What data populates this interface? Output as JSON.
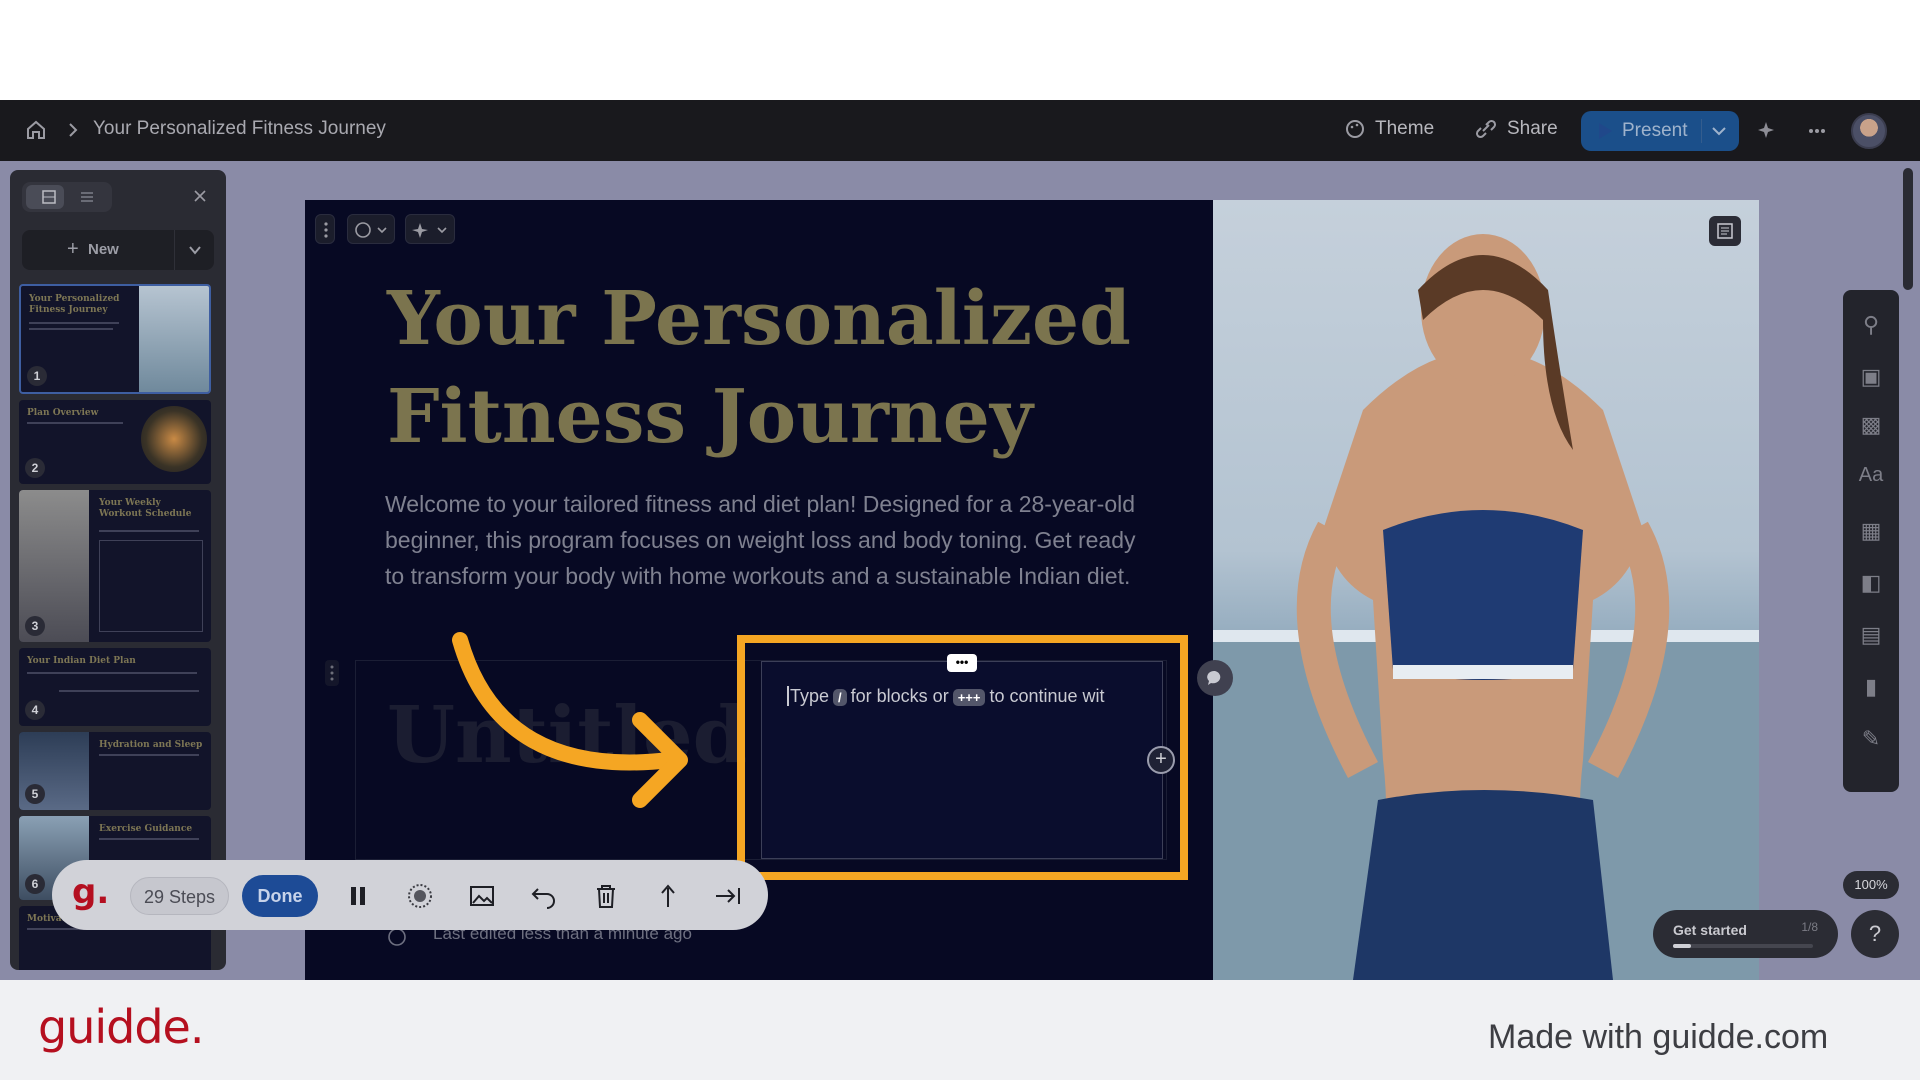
{
  "topbar": {
    "breadcrumb": "Your Personalized Fitness Journey",
    "theme": "Theme",
    "share": "Share",
    "present": "Present"
  },
  "sidebar": {
    "new_label": "New",
    "slides": [
      {
        "num": "1",
        "title": "Your Personalized Fitness Journey"
      },
      {
        "num": "2",
        "title": "Plan Overview"
      },
      {
        "num": "3",
        "title": "Your Weekly Workout Schedule"
      },
      {
        "num": "4",
        "title": "Your Indian Diet Plan"
      },
      {
        "num": "5",
        "title": "Hydration and Sleep"
      },
      {
        "num": "6",
        "title": "Exercise Guidance"
      },
      {
        "num": "",
        "title": "Motivation and Mindset"
      }
    ]
  },
  "slide": {
    "title": "Your Personalized Fitness Journey",
    "intro": "Welcome to your tailored fitness and diet plan! Designed for a 28-year-old beginner, this program focuses on weight loss and body toning. Get ready to transform your body with home workouts and a sustainable Indian diet.",
    "card_title": "Untitled",
    "editor_hint_1": "Type",
    "editor_key_1": "/",
    "editor_hint_2": "for blocks or",
    "editor_key_2": "+++",
    "editor_hint_3": "to continue wit",
    "last_edited": "Last edited less than a minute ago"
  },
  "zoom": "100%",
  "get_started": {
    "label": "Get started",
    "progress": "1/8"
  },
  "help": "?",
  "guidde_toolbar": {
    "logo": "g.",
    "steps": "29 Steps",
    "done": "Done"
  },
  "footer": {
    "brand": "guidde.",
    "made_with": "Made with guidde.com"
  },
  "colors": {
    "highlight": "#f5a623",
    "arrow": "#f5a623",
    "brand": "#b5101f",
    "present": "#1b4f8a"
  }
}
